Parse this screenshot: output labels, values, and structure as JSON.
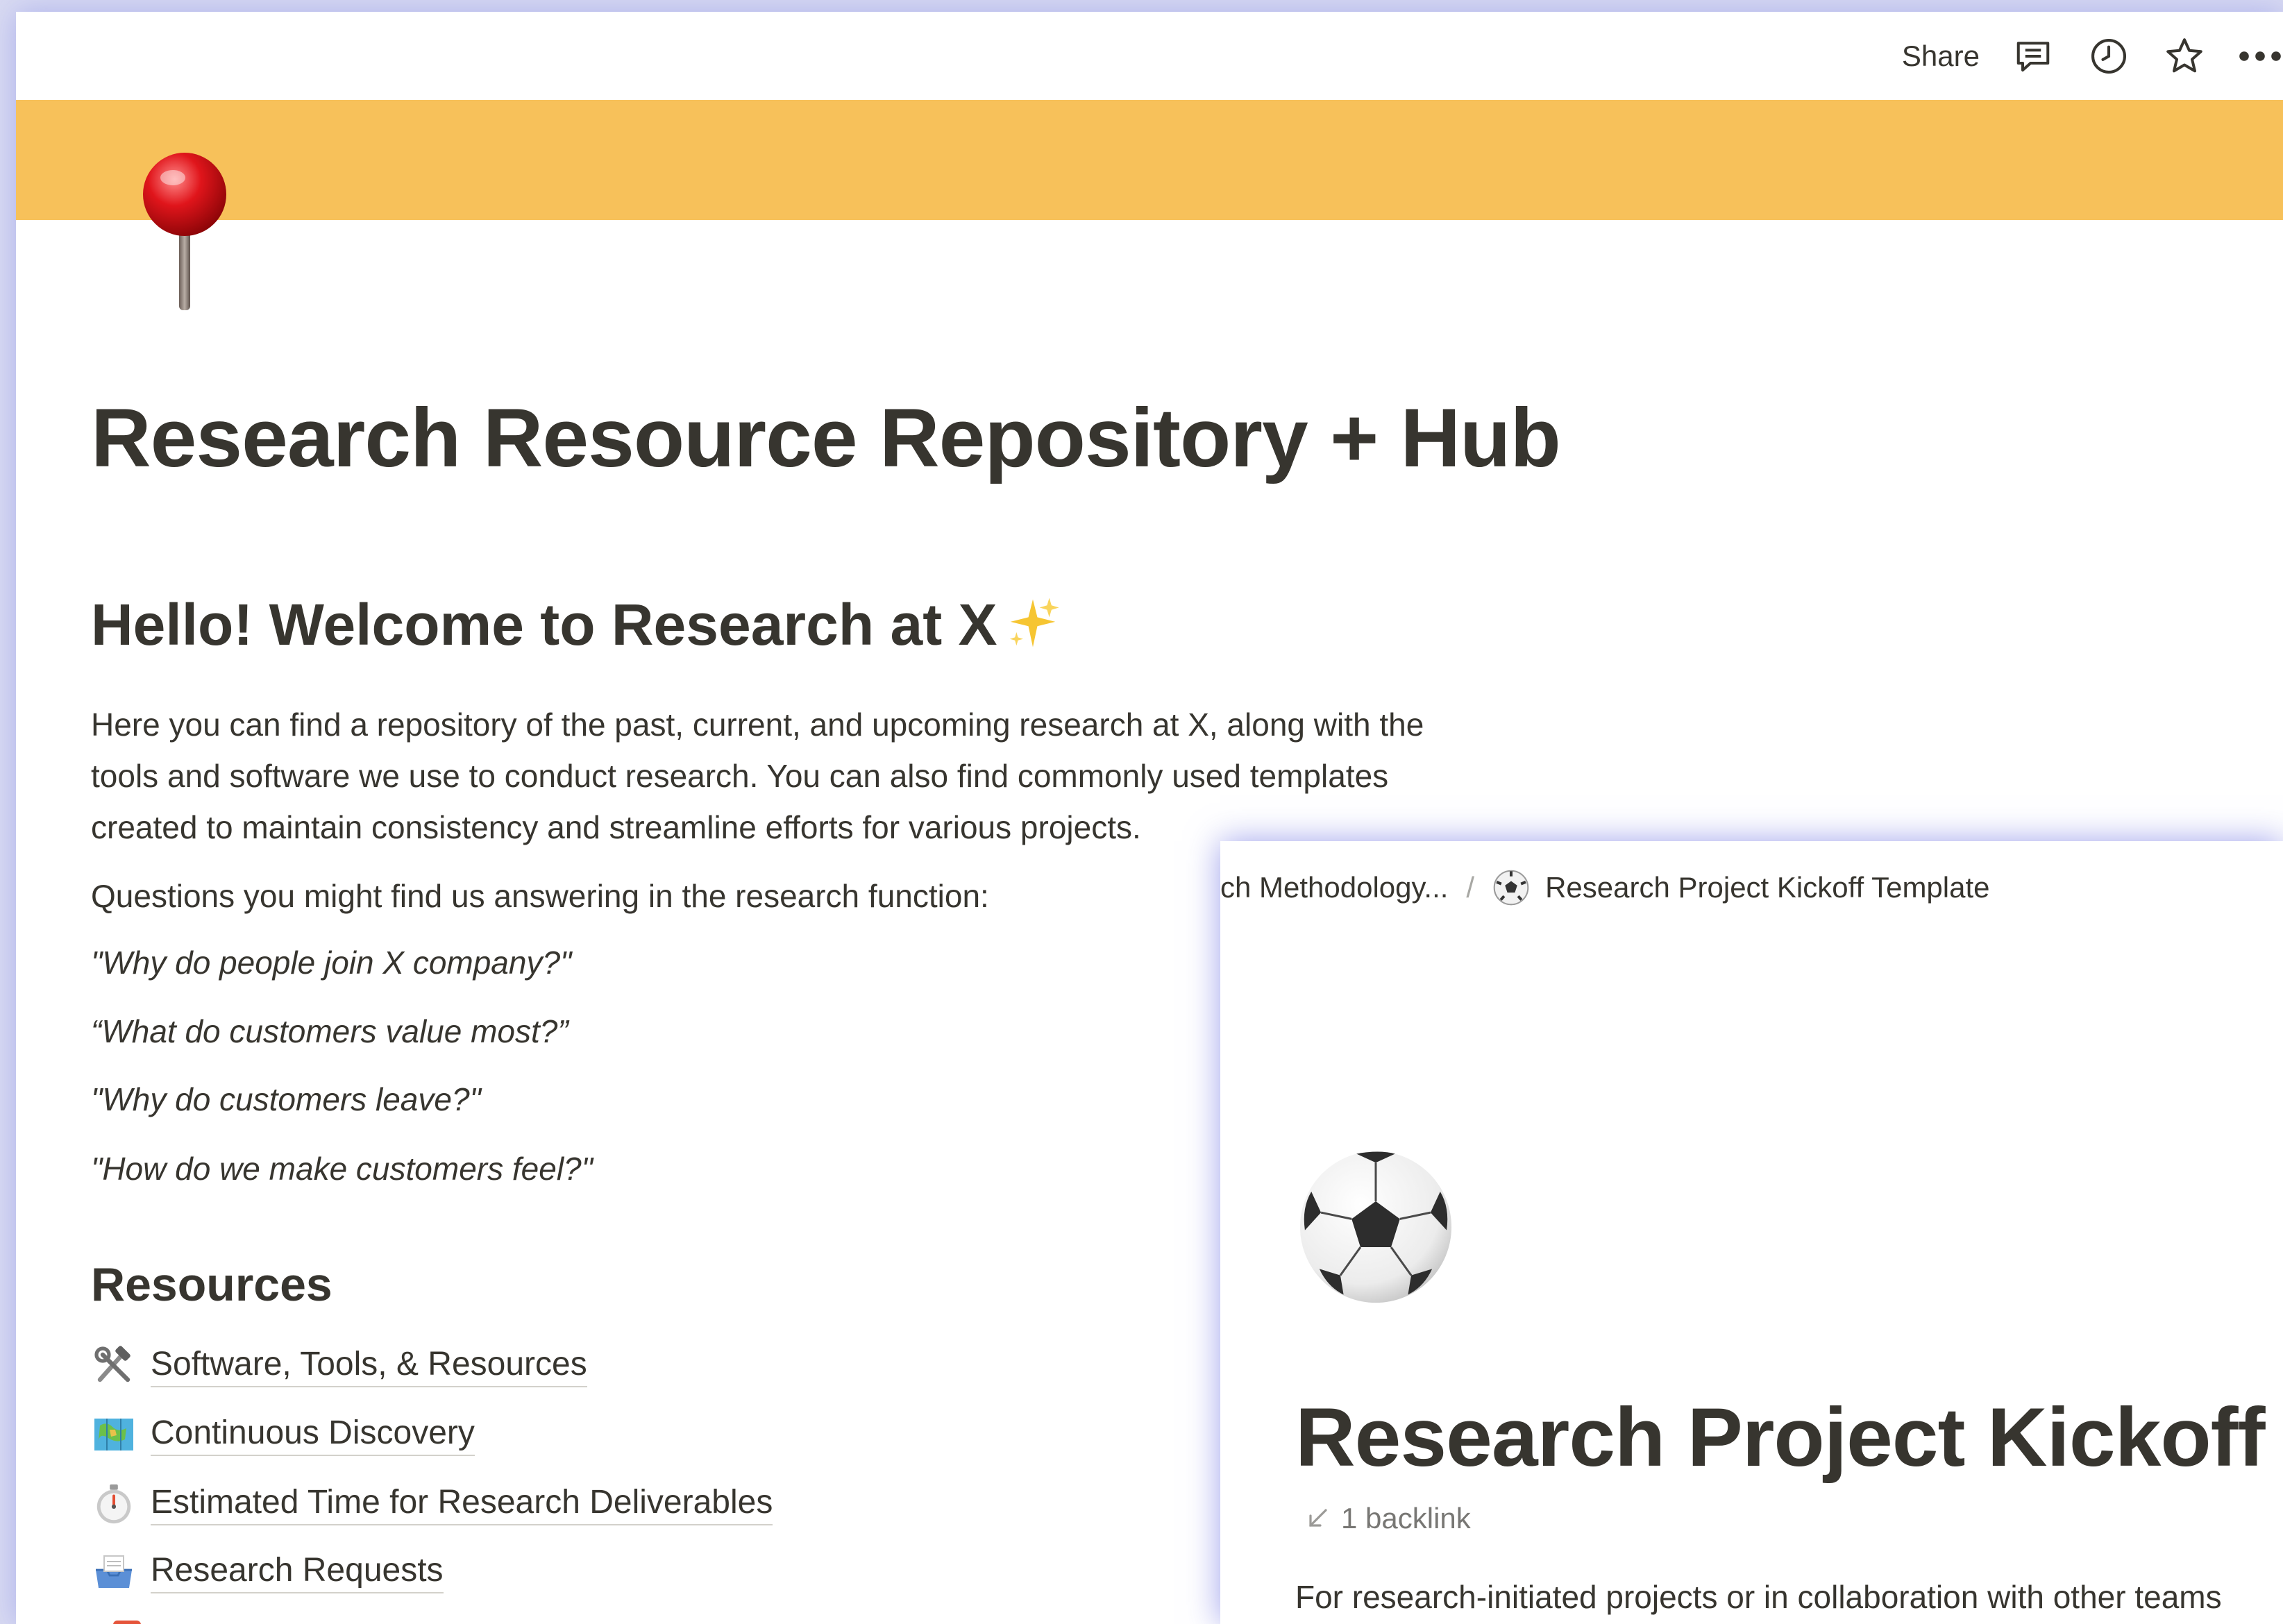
{
  "topbar": {
    "share_label": "Share",
    "icons": [
      "comment-icon",
      "clock-icon",
      "star-icon",
      "more-icon"
    ]
  },
  "cover": {
    "color": "#f7c15a"
  },
  "page": {
    "icon": "pushpin-icon",
    "title": "Research Resource Repository + Hub",
    "welcome_heading": "Hello! Welcome to Research at X",
    "intro_lines": [
      "Here you can find a repository of the past, current, and upcoming research at X, along with the",
      "tools and software we use to conduct research. You can also find commonly used templates",
      "created to maintain consistency and streamline efforts for various projects."
    ],
    "questions_intro": "Questions you might find us answering in the research function:",
    "questions": [
      "\"Why do people join X company?\"",
      "“What do customers value most?”",
      "\"Why do customers leave?\"",
      "\"How do we make customers feel?\""
    ],
    "resources_heading": "Resources",
    "resources": [
      {
        "icon": "hammer-wrench-icon",
        "label": "Software, Tools, & Resources"
      },
      {
        "icon": "map-icon",
        "label": "Continuous Discovery"
      },
      {
        "icon": "stopwatch-icon",
        "label": "Estimated Time for Research Deliverables"
      },
      {
        "icon": "inbox-tray-icon",
        "label": "Research Requests"
      }
    ]
  },
  "overlay": {
    "breadcrumb": {
      "parent": "ch Methodology...",
      "separator": "/",
      "current_icon": "soccer-ball-icon",
      "current": "Research Project Kickoff Template"
    },
    "icon": "soccer-ball-icon",
    "title": "Research Project Kickoff Template",
    "backlink": "1 backlink",
    "description": "For research-initiated projects or in collaboration with other teams"
  },
  "colors": {
    "text": "#37352f",
    "muted": "#787774",
    "overlay_glow": "#7d82e6"
  }
}
